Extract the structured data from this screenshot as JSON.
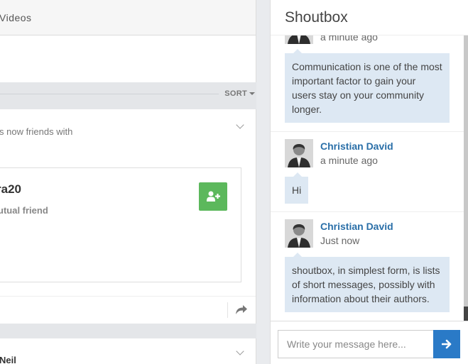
{
  "feed": {
    "tab_label": "Videos",
    "sort_label": "SORT",
    "activity_text": "s now friends with",
    "friend": {
      "username": "ra20",
      "mutual_text": "utual friend"
    },
    "next_card_name": "Neil"
  },
  "shoutbox": {
    "title": "Shoutbox",
    "messages": [
      {
        "author": "",
        "time": "a minute ago",
        "text": "Communication is one of the most important factor to gain your users stay on your community longer."
      },
      {
        "author": "Christian David",
        "time": "a minute ago",
        "text": "Hi"
      },
      {
        "author": "Christian David",
        "time": "Just now",
        "text": "shoutbox, in simplest form, is lists of short messages, possibly with information about their authors."
      }
    ],
    "input_placeholder": "Write your message here...",
    "send_icon": "arrow-right-icon"
  },
  "colors": {
    "accent_blue": "#2a7ac7",
    "author_blue": "#2a6fa8",
    "bubble_bg": "#dde8f3",
    "add_friend_green": "#5cb85c"
  }
}
